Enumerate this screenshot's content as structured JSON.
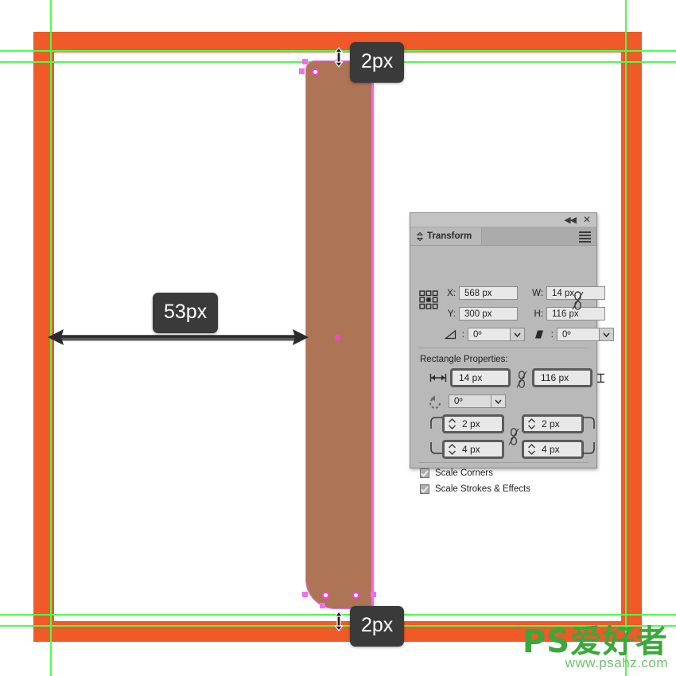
{
  "app": {
    "name": "Adobe Illustrator",
    "canvas_background": "#ffffff",
    "artboard_frame_color": "#f05a28",
    "guide_color": "#4dfd4d",
    "selection_color": "#ff3ddc",
    "shape_fill_color": "#ad7456"
  },
  "smart_guides": {
    "top_label": "2px",
    "bottom_label": "2px",
    "width_label": "53px"
  },
  "panel": {
    "title": "Transform",
    "collapse_icon": "double-chevron-left-icon",
    "close_icon": "close-icon",
    "menu_icon": "panel-menu-icon",
    "reference_point_icon": "reference-point-widget",
    "transform": {
      "x_label": "X:",
      "x_value": "568 px",
      "y_label": "Y:",
      "y_value": "300 px",
      "w_label": "W:",
      "w_value": "14 px",
      "h_label": "H:",
      "h_value": "116 px",
      "link_wh_icon": "broken-link-icon",
      "rotate_label_icon": "shear-angle-icon",
      "rotate_value": "0º",
      "shear_label_icon": "slant-angle-icon",
      "shear_value": "0º"
    },
    "rectangle_properties": {
      "section_title": "Rectangle Properties:",
      "width_icon": "horizontal-width-icon",
      "width_value": "14 px",
      "height_icon": "vertical-height-icon",
      "height_value": "116 px",
      "link_size_icon": "broken-link-icon",
      "angle_icon": "rotate-icon",
      "angle_value": "0º",
      "corner_top_left_icon": "corner-top-left-icon",
      "corner_top_left": "2 px",
      "corner_top_right_icon": "corner-top-right-icon",
      "corner_top_right": "2 px",
      "corner_bottom_left_icon": "corner-bottom-left-icon",
      "corner_bottom_left": "4 px",
      "corner_bottom_right_icon": "corner-bottom-right-icon",
      "corner_bottom_right": "4 px",
      "link_corners_icon": "broken-link-icon"
    },
    "options": [
      {
        "label": "Scale Corners",
        "checked": true
      },
      {
        "label": "Scale Strokes & Effects",
        "checked": true
      }
    ]
  },
  "watermark": {
    "main": "PS爱好者",
    "sub": "www.psahz.com"
  }
}
